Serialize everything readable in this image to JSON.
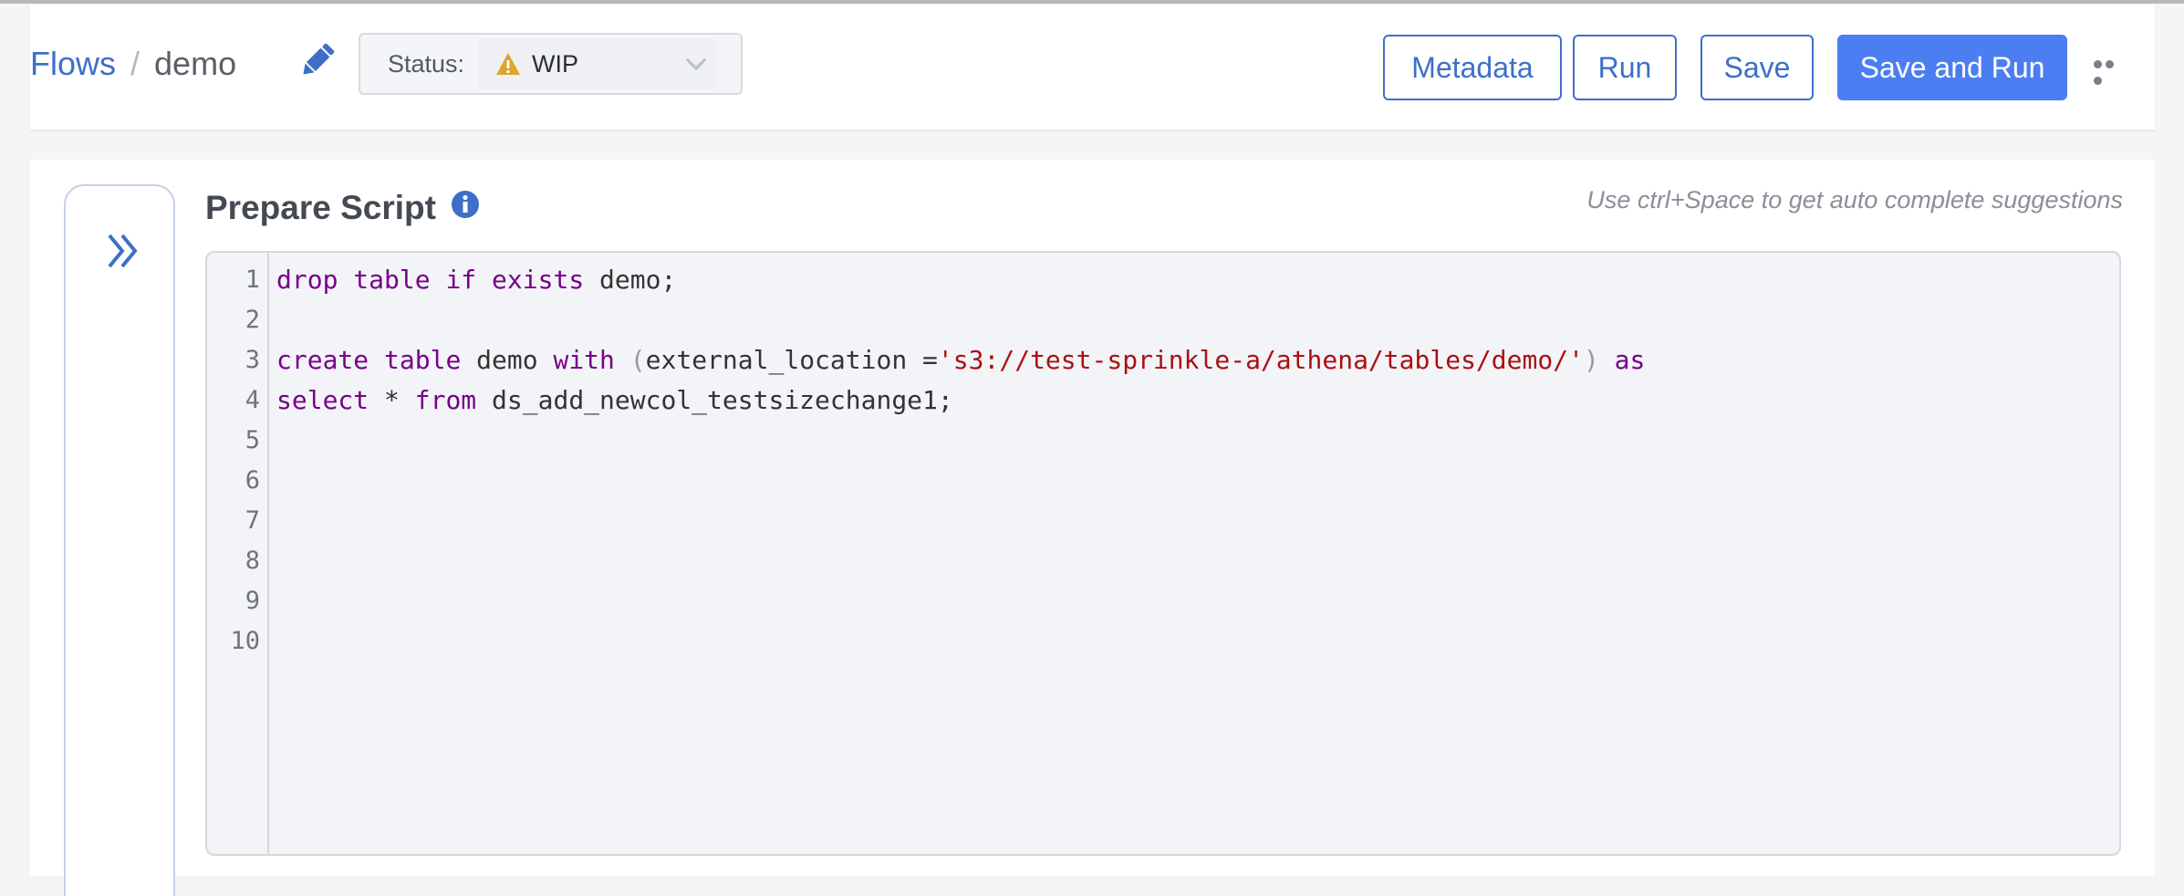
{
  "breadcrumb": {
    "root": "Flows",
    "separator": "/",
    "current": "demo"
  },
  "status": {
    "label": "Status:",
    "value": "WIP",
    "warning_color": "#e0a32b"
  },
  "toolbar": {
    "metadata_label": "Metadata",
    "run_label": "Run",
    "save_label": "Save",
    "save_and_run_label": "Save and Run"
  },
  "editor": {
    "title": "Prepare Script",
    "hint": "Use ctrl+Space to get auto complete suggestions",
    "line_numbers": [
      "1",
      "2",
      "3",
      "4",
      "5",
      "6",
      "7",
      "8",
      "9",
      "10"
    ],
    "line1": {
      "kw1": "drop",
      "sp1": " ",
      "kw2": "table",
      "sp2": " ",
      "kw3": "if",
      "sp3": " ",
      "kw4": "exists",
      "rest": " demo;"
    },
    "line3": {
      "kw1": "create",
      "sp1": " ",
      "kw2": "table",
      "mid1": " demo ",
      "kw3": "with",
      "sp2": " ",
      "p1": "(",
      "mid2": "external_location =",
      "str": "'s3://test-sprinkle-a/athena/tables/demo/'",
      "p2": ")",
      "sp3": " ",
      "kw4": "as"
    },
    "line4": {
      "kw1": "select",
      "mid": " * ",
      "kw2": "from",
      "rest": " ds_add_newcol_testsizechange1;"
    }
  },
  "colors": {
    "accent": "#3d6fc9",
    "primary_button": "#4a7ef2",
    "keyword": "#770088",
    "string": "#aa1111"
  },
  "icons": {
    "edit": "pencil-icon",
    "warning": "warning-icon",
    "dropdown": "chevron-down-icon",
    "more": "more-horizontal-icon",
    "expand": "double-chevron-right-icon",
    "info": "info-icon"
  }
}
